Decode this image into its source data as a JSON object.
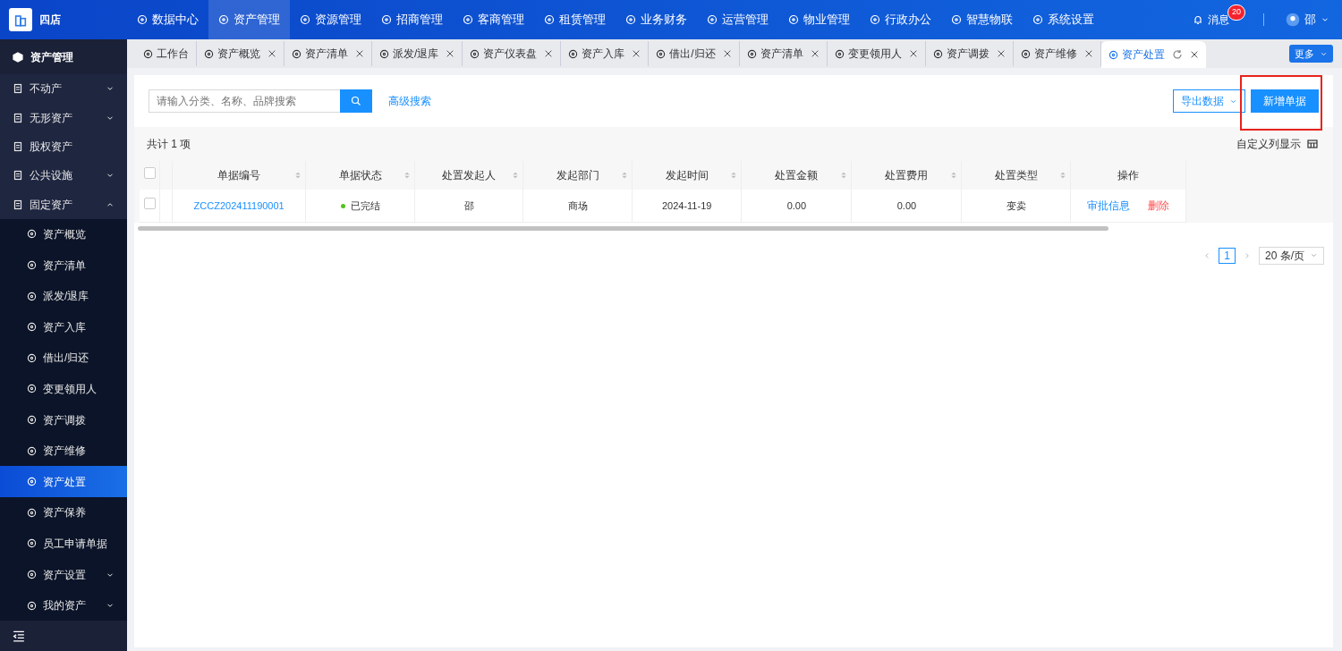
{
  "brand": {
    "name": "四店"
  },
  "top_nav": [
    {
      "label": "数据中心",
      "selected": false
    },
    {
      "label": "资产管理",
      "selected": true
    },
    {
      "label": "资源管理",
      "selected": false
    },
    {
      "label": "招商管理",
      "selected": false
    },
    {
      "label": "客商管理",
      "selected": false
    },
    {
      "label": "租赁管理",
      "selected": false
    },
    {
      "label": "业务财务",
      "selected": false
    },
    {
      "label": "运营管理",
      "selected": false
    },
    {
      "label": "物业管理",
      "selected": false
    },
    {
      "label": "行政办公",
      "selected": false
    },
    {
      "label": "智慧物联",
      "selected": false
    },
    {
      "label": "系统设置",
      "selected": false
    }
  ],
  "messages": {
    "label": "消息",
    "badge": "20"
  },
  "user": {
    "name": "邵"
  },
  "sidebar": {
    "title": "资产管理",
    "items": [
      {
        "label": "不动产",
        "expanded": false
      },
      {
        "label": "无形资产",
        "expanded": false
      },
      {
        "label": "股权资产"
      },
      {
        "label": "公共设施",
        "expanded": false
      },
      {
        "label": "固定资产",
        "expanded": true,
        "children": [
          {
            "label": "资产概览",
            "selected": false
          },
          {
            "label": "资产清单",
            "selected": false
          },
          {
            "label": "派发/退库",
            "selected": false
          },
          {
            "label": "资产入库",
            "selected": false
          },
          {
            "label": "借出/归还",
            "selected": false
          },
          {
            "label": "变更领用人",
            "selected": false
          },
          {
            "label": "资产调拨",
            "selected": false
          },
          {
            "label": "资产维修",
            "selected": false
          },
          {
            "label": "资产处置",
            "selected": true
          },
          {
            "label": "资产保养",
            "selected": false
          },
          {
            "label": "员工申请单据",
            "selected": false
          },
          {
            "label": "资产设置",
            "selected": false,
            "expanded": false
          },
          {
            "label": "我的资产",
            "selected": false,
            "expanded": false
          }
        ]
      }
    ]
  },
  "tabs": [
    {
      "label": "工作台",
      "selected": false,
      "closable": false
    },
    {
      "label": "资产概览",
      "selected": false,
      "closable": true
    },
    {
      "label": "资产清单",
      "selected": false,
      "closable": true
    },
    {
      "label": "派发/退库",
      "selected": false,
      "closable": true
    },
    {
      "label": "资产仪表盘",
      "selected": false,
      "closable": true
    },
    {
      "label": "资产入库",
      "selected": false,
      "closable": true
    },
    {
      "label": "借出/归还",
      "selected": false,
      "closable": true
    },
    {
      "label": "资产清单",
      "selected": false,
      "closable": true
    },
    {
      "label": "变更领用人",
      "selected": false,
      "closable": true
    },
    {
      "label": "资产调拨",
      "selected": false,
      "closable": true
    },
    {
      "label": "资产维修",
      "selected": false,
      "closable": true
    },
    {
      "label": "资产处置",
      "selected": true,
      "closable": true
    }
  ],
  "more_button": "更多",
  "search": {
    "placeholder": "请输入分类、名称、品牌搜索"
  },
  "advanced_search": "高级搜索",
  "export_button": "导出数据",
  "new_button": {
    "label": "新增单据",
    "highlighted": true
  },
  "total": "共计 1 项",
  "custom_columns": "自定义列显示",
  "table": {
    "select_all": false,
    "columns": [
      {
        "label": "单据编号",
        "sortable": true
      },
      {
        "label": "单据状态",
        "sortable": true
      },
      {
        "label": "处置发起人",
        "sortable": true
      },
      {
        "label": "发起部门",
        "sortable": true
      },
      {
        "label": "发起时间",
        "sortable": true
      },
      {
        "label": "处置金额",
        "sortable": true
      },
      {
        "label": "处置费用",
        "sortable": true
      },
      {
        "label": "处置类型",
        "sortable": true
      },
      {
        "label": "操作",
        "sortable": false
      }
    ],
    "rows": [
      {
        "checked": false,
        "cells": [
          "ZCCZ202411190001",
          "已完结",
          "邵",
          "商场",
          "2024-11-19",
          "0.00",
          "0.00",
          "变卖"
        ],
        "actions": [
          {
            "label": "审批信息",
            "kind": "link"
          },
          {
            "label": "删除",
            "kind": "danger"
          }
        ]
      }
    ]
  },
  "pagination": {
    "pages": [
      {
        "label": "1",
        "selected": true
      }
    ],
    "page_size": "20 条/页"
  }
}
